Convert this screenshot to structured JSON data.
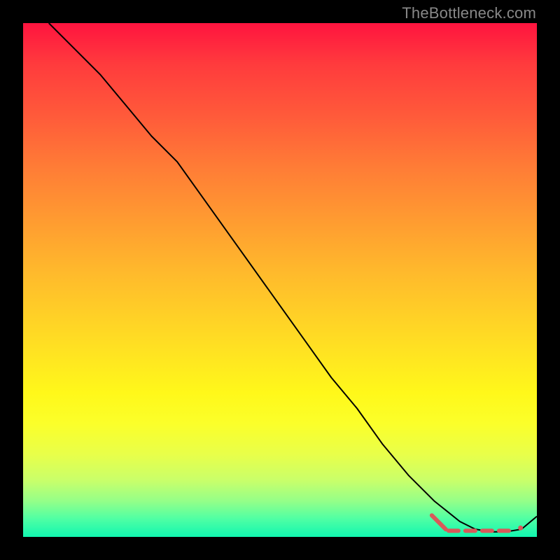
{
  "watermark": "TheBottleneck.com",
  "colors": {
    "dash": "#d85a5a",
    "curve": "#000000"
  },
  "chart_data": {
    "type": "line",
    "title": "",
    "xlabel": "",
    "ylabel": "",
    "xlim": [
      0,
      100
    ],
    "ylim": [
      0,
      100
    ],
    "grid": false,
    "series": [
      {
        "name": "curve",
        "x": [
          5,
          10,
          15,
          20,
          25,
          30,
          35,
          40,
          45,
          50,
          55,
          60,
          65,
          70,
          75,
          80,
          85,
          88,
          91,
          94,
          97,
          100
        ],
        "values": [
          100,
          95,
          90,
          84,
          78,
          73,
          66,
          59,
          52,
          45,
          38,
          31,
          25,
          18,
          12,
          7,
          3,
          1.5,
          1,
          1,
          1.5,
          4
        ]
      }
    ],
    "highlight_dashes": {
      "description": "salmon dashed marks along the valley of the curve near the bottom-right",
      "x_start": 82,
      "x_end": 96,
      "y": 1.2
    }
  }
}
